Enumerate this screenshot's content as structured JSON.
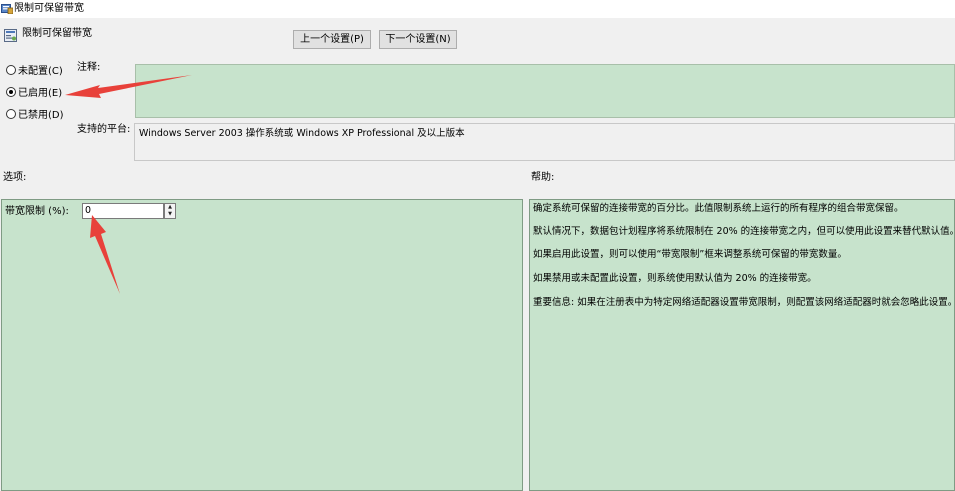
{
  "window": {
    "title": "限制可保留带宽"
  },
  "header": {
    "policy_name": "限制可保留带宽"
  },
  "nav": {
    "prev_label": "上一个设置(P)",
    "next_label": "下一个设置(N)"
  },
  "state": {
    "options": [
      {
        "label": "未配置(C)",
        "checked": false
      },
      {
        "label": "已启用(E)",
        "checked": true
      },
      {
        "label": "已禁用(D)",
        "checked": false
      }
    ]
  },
  "comment": {
    "label": "注释:",
    "value": ""
  },
  "platform": {
    "label": "支持的平台:",
    "value": "Windows Server 2003 操作系统或 Windows XP Professional 及以上版本"
  },
  "options_section": {
    "heading": "选项:",
    "bandwidth_label": "带宽限制 (%):",
    "bandwidth_value": "0"
  },
  "help_section": {
    "heading": "帮助:",
    "lines": [
      "确定系统可保留的连接带宽的百分比。此值限制系统上运行的所有程序的组合带宽保留。",
      "默认情况下，数据包计划程序将系统限制在 20% 的连接带宽之内，但可以使用此设置来替代默认值。",
      "如果启用此设置，则可以使用“带宽限制”框来调整系统可保留的带宽数量。",
      "如果禁用或未配置此设置，则系统使用默认值为 20% 的连接带宽。",
      "重要信息: 如果在注册表中为特定网络适配器设置带宽限制，则配置该网络适配器时就会忽略此设置。"
    ]
  },
  "colors": {
    "panel_green": "#c7e3cc",
    "annotation_red": "#e8413a"
  }
}
